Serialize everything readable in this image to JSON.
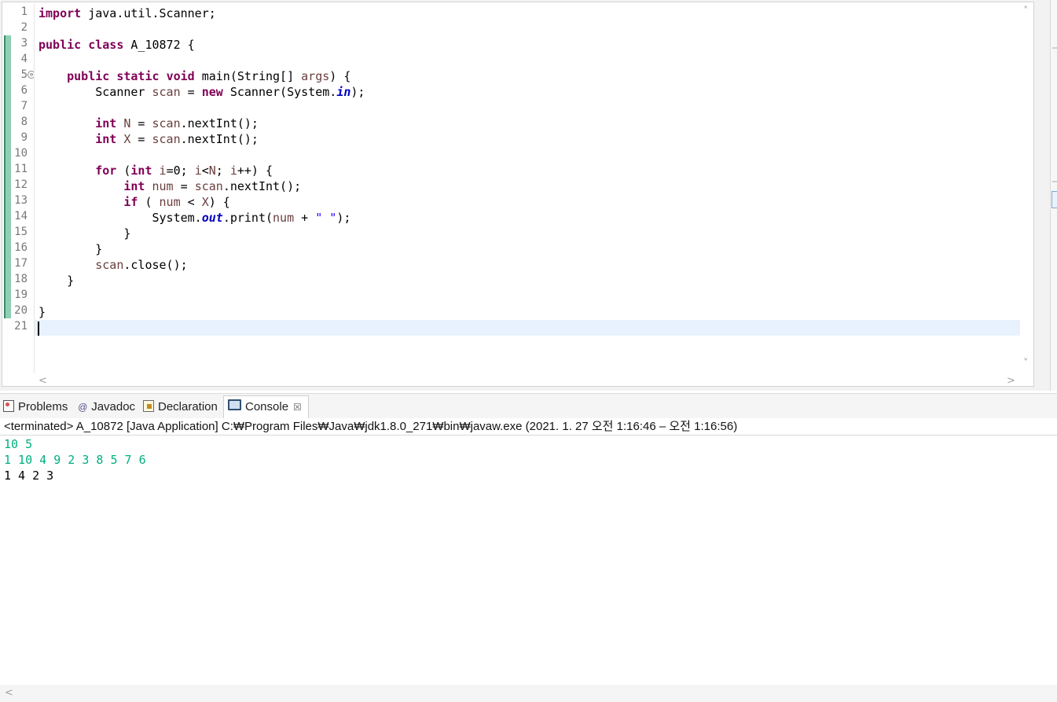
{
  "editor": {
    "line_numbers": [
      "1",
      "2",
      "3",
      "4",
      "5",
      "6",
      "7",
      "8",
      "9",
      "10",
      "11",
      "12",
      "13",
      "14",
      "15",
      "16",
      "17",
      "18",
      "19",
      "20",
      "21"
    ],
    "fold_marker": "⊖",
    "lines": [
      {
        "t": [
          {
            "c": "kw",
            "s": "import"
          },
          {
            "c": "",
            "s": " java.util.Scanner;"
          }
        ]
      },
      {
        "t": []
      },
      {
        "t": [
          {
            "c": "kw",
            "s": "public"
          },
          {
            "c": "",
            "s": " "
          },
          {
            "c": "kw",
            "s": "class"
          },
          {
            "c": "",
            "s": " A_10872 {"
          }
        ]
      },
      {
        "t": []
      },
      {
        "t": [
          {
            "c": "",
            "s": "    "
          },
          {
            "c": "kw",
            "s": "public"
          },
          {
            "c": "",
            "s": " "
          },
          {
            "c": "kw",
            "s": "static"
          },
          {
            "c": "",
            "s": " "
          },
          {
            "c": "kw",
            "s": "void"
          },
          {
            "c": "",
            "s": " main(String[] "
          },
          {
            "c": "par",
            "s": "args"
          },
          {
            "c": "",
            "s": ") {"
          }
        ]
      },
      {
        "t": [
          {
            "c": "",
            "s": "        Scanner "
          },
          {
            "c": "var",
            "s": "scan"
          },
          {
            "c": "",
            "s": " = "
          },
          {
            "c": "kw",
            "s": "new"
          },
          {
            "c": "",
            "s": " Scanner(System."
          },
          {
            "c": "fld",
            "s": "in"
          },
          {
            "c": "",
            "s": ");"
          }
        ]
      },
      {
        "t": []
      },
      {
        "t": [
          {
            "c": "",
            "s": "        "
          },
          {
            "c": "kw",
            "s": "int"
          },
          {
            "c": "",
            "s": " "
          },
          {
            "c": "var",
            "s": "N"
          },
          {
            "c": "",
            "s": " = "
          },
          {
            "c": "var",
            "s": "scan"
          },
          {
            "c": "",
            "s": ".nextInt();"
          }
        ]
      },
      {
        "t": [
          {
            "c": "",
            "s": "        "
          },
          {
            "c": "kw",
            "s": "int"
          },
          {
            "c": "",
            "s": " "
          },
          {
            "c": "var",
            "s": "X"
          },
          {
            "c": "",
            "s": " = "
          },
          {
            "c": "var",
            "s": "scan"
          },
          {
            "c": "",
            "s": ".nextInt();"
          }
        ]
      },
      {
        "t": []
      },
      {
        "t": [
          {
            "c": "",
            "s": "        "
          },
          {
            "c": "kw",
            "s": "for"
          },
          {
            "c": "",
            "s": " ("
          },
          {
            "c": "kw",
            "s": "int"
          },
          {
            "c": "",
            "s": " "
          },
          {
            "c": "var",
            "s": "i"
          },
          {
            "c": "",
            "s": "=0; "
          },
          {
            "c": "var",
            "s": "i"
          },
          {
            "c": "",
            "s": "<"
          },
          {
            "c": "var",
            "s": "N"
          },
          {
            "c": "",
            "s": "; "
          },
          {
            "c": "var",
            "s": "i"
          },
          {
            "c": "",
            "s": "++) {"
          }
        ]
      },
      {
        "t": [
          {
            "c": "",
            "s": "            "
          },
          {
            "c": "kw",
            "s": "int"
          },
          {
            "c": "",
            "s": " "
          },
          {
            "c": "var",
            "s": "num"
          },
          {
            "c": "",
            "s": " = "
          },
          {
            "c": "var",
            "s": "scan"
          },
          {
            "c": "",
            "s": ".nextInt();"
          }
        ]
      },
      {
        "t": [
          {
            "c": "",
            "s": "            "
          },
          {
            "c": "kw",
            "s": "if"
          },
          {
            "c": "",
            "s": " ( "
          },
          {
            "c": "var",
            "s": "num"
          },
          {
            "c": "",
            "s": " < "
          },
          {
            "c": "var",
            "s": "X"
          },
          {
            "c": "",
            "s": ") {"
          }
        ]
      },
      {
        "t": [
          {
            "c": "",
            "s": "                System."
          },
          {
            "c": "fld",
            "s": "out"
          },
          {
            "c": "",
            "s": ".print("
          },
          {
            "c": "var",
            "s": "num"
          },
          {
            "c": "",
            "s": " + "
          },
          {
            "c": "str",
            "s": "\" \""
          },
          {
            "c": "",
            "s": ");"
          }
        ]
      },
      {
        "t": [
          {
            "c": "",
            "s": "            }"
          }
        ]
      },
      {
        "t": [
          {
            "c": "",
            "s": "        }"
          }
        ]
      },
      {
        "t": [
          {
            "c": "",
            "s": "        "
          },
          {
            "c": "var",
            "s": "scan"
          },
          {
            "c": "",
            "s": ".close();"
          }
        ]
      },
      {
        "t": [
          {
            "c": "",
            "s": "    }"
          }
        ]
      },
      {
        "t": []
      },
      {
        "t": [
          {
            "c": "",
            "s": "}"
          }
        ]
      },
      {
        "t": []
      }
    ],
    "scroll_up": "˄",
    "scroll_down": "˅",
    "scroll_left": "<",
    "scroll_right": ">"
  },
  "tabs": [
    {
      "label": "Problems",
      "icon": "problems-icon"
    },
    {
      "label": "Javadoc",
      "icon": "javadoc-icon",
      "glyph": "@"
    },
    {
      "label": "Declaration",
      "icon": "declaration-icon"
    },
    {
      "label": "Console",
      "icon": "console-icon",
      "active": true,
      "close": "☒"
    }
  ],
  "console": {
    "status": "<terminated> A_10872 [Java Application] C:₩Program Files₩Java₩jdk1.8.0_271₩bin₩javaw.exe  (2021. 1. 27 오전 1:16:46 – 오전 1:16:56)",
    "lines": [
      {
        "kind": "in",
        "text": "10 5"
      },
      {
        "kind": "in",
        "text": "1 10 4 9 2 3 8 5 7 6"
      },
      {
        "kind": "res",
        "text": "1 4 2 3"
      }
    ],
    "scroll_left": "<"
  },
  "colors": {
    "keyword": "#7f0055",
    "field": "#0000c0",
    "string": "#2a00ff",
    "local_var": "#6a3e3e",
    "console_input": "#00b080"
  }
}
